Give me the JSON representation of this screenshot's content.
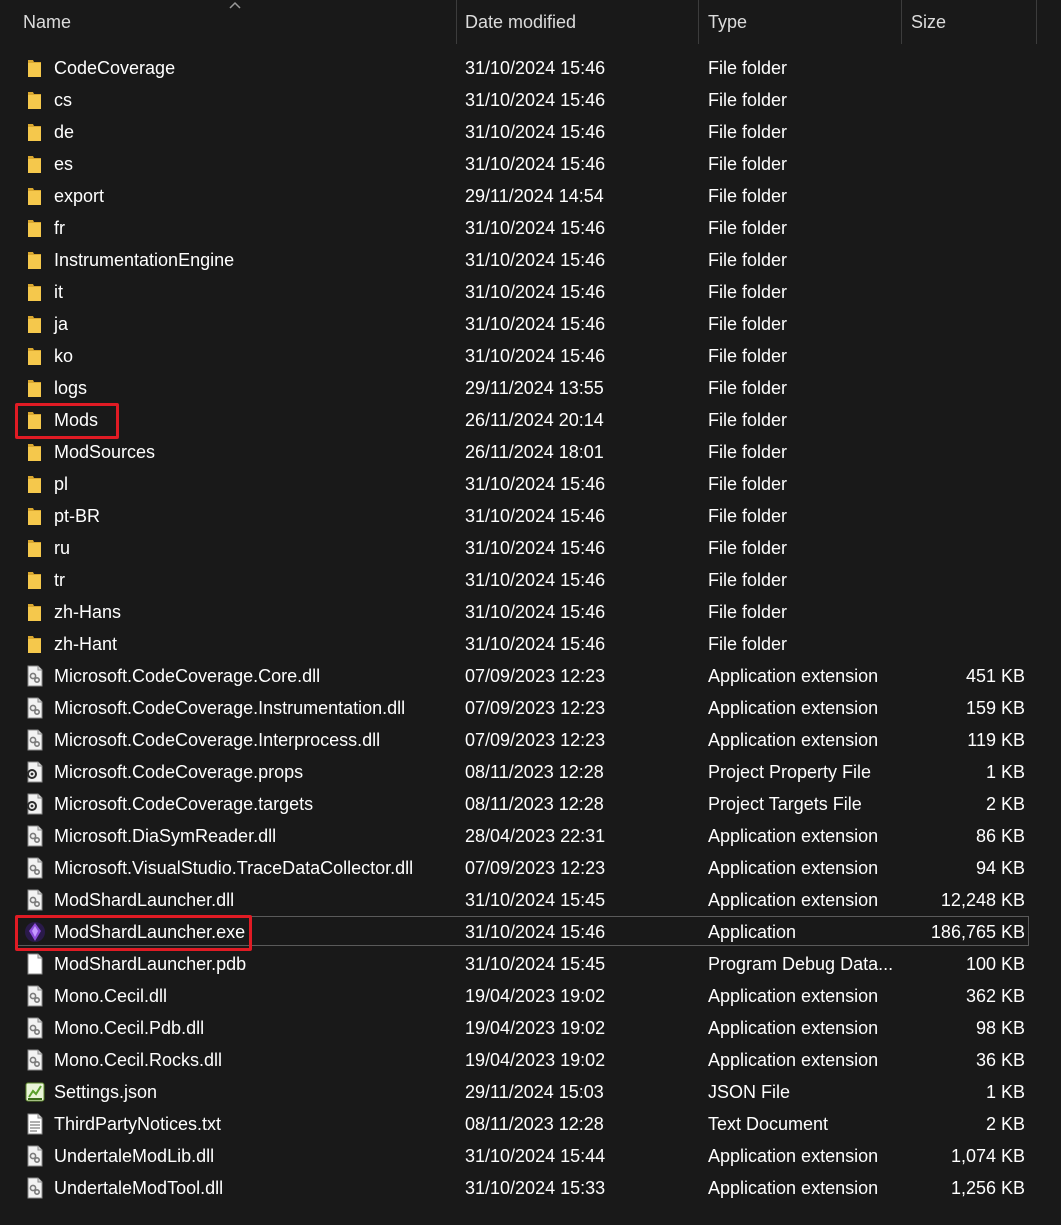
{
  "columns": {
    "name": "Name",
    "date": "Date modified",
    "type": "Type",
    "size": "Size"
  },
  "colors": {
    "background": "#191919",
    "text": "#ffffff",
    "folder": "#f5c84c",
    "highlight": "#e01b24"
  },
  "files": [
    {
      "name": "CodeCoverage",
      "date": "31/10/2024 15:46",
      "type": "File folder",
      "size": "",
      "icon": "folder-icon"
    },
    {
      "name": "cs",
      "date": "31/10/2024 15:46",
      "type": "File folder",
      "size": "",
      "icon": "folder-icon"
    },
    {
      "name": "de",
      "date": "31/10/2024 15:46",
      "type": "File folder",
      "size": "",
      "icon": "folder-icon"
    },
    {
      "name": "es",
      "date": "31/10/2024 15:46",
      "type": "File folder",
      "size": "",
      "icon": "folder-icon"
    },
    {
      "name": "export",
      "date": "29/11/2024 14:54",
      "type": "File folder",
      "size": "",
      "icon": "folder-icon"
    },
    {
      "name": "fr",
      "date": "31/10/2024 15:46",
      "type": "File folder",
      "size": "",
      "icon": "folder-icon"
    },
    {
      "name": "InstrumentationEngine",
      "date": "31/10/2024 15:46",
      "type": "File folder",
      "size": "",
      "icon": "folder-icon"
    },
    {
      "name": "it",
      "date": "31/10/2024 15:46",
      "type": "File folder",
      "size": "",
      "icon": "folder-icon"
    },
    {
      "name": "ja",
      "date": "31/10/2024 15:46",
      "type": "File folder",
      "size": "",
      "icon": "folder-icon"
    },
    {
      "name": "ko",
      "date": "31/10/2024 15:46",
      "type": "File folder",
      "size": "",
      "icon": "folder-icon"
    },
    {
      "name": "logs",
      "date": "29/11/2024 13:55",
      "type": "File folder",
      "size": "",
      "icon": "folder-icon"
    },
    {
      "name": "Mods",
      "date": "26/11/2024 20:14",
      "type": "File folder",
      "size": "",
      "icon": "folder-icon",
      "highlighted": true
    },
    {
      "name": "ModSources",
      "date": "26/11/2024 18:01",
      "type": "File folder",
      "size": "",
      "icon": "folder-icon"
    },
    {
      "name": "pl",
      "date": "31/10/2024 15:46",
      "type": "File folder",
      "size": "",
      "icon": "folder-icon"
    },
    {
      "name": "pt-BR",
      "date": "31/10/2024 15:46",
      "type": "File folder",
      "size": "",
      "icon": "folder-icon"
    },
    {
      "name": "ru",
      "date": "31/10/2024 15:46",
      "type": "File folder",
      "size": "",
      "icon": "folder-icon"
    },
    {
      "name": "tr",
      "date": "31/10/2024 15:46",
      "type": "File folder",
      "size": "",
      "icon": "folder-icon"
    },
    {
      "name": "zh-Hans",
      "date": "31/10/2024 15:46",
      "type": "File folder",
      "size": "",
      "icon": "folder-icon"
    },
    {
      "name": "zh-Hant",
      "date": "31/10/2024 15:46",
      "type": "File folder",
      "size": "",
      "icon": "folder-icon"
    },
    {
      "name": "Microsoft.CodeCoverage.Core.dll",
      "date": "07/09/2023 12:23",
      "type": "Application extension",
      "size": "451 KB",
      "icon": "dll-icon"
    },
    {
      "name": "Microsoft.CodeCoverage.Instrumentation.dll",
      "date": "07/09/2023 12:23",
      "type": "Application extension",
      "size": "159 KB",
      "icon": "dll-icon"
    },
    {
      "name": "Microsoft.CodeCoverage.Interprocess.dll",
      "date": "07/09/2023 12:23",
      "type": "Application extension",
      "size": "119 KB",
      "icon": "dll-icon"
    },
    {
      "name": "Microsoft.CodeCoverage.props",
      "date": "08/11/2023 12:28",
      "type": "Project Property File",
      "size": "1 KB",
      "icon": "project-file-icon"
    },
    {
      "name": "Microsoft.CodeCoverage.targets",
      "date": "08/11/2023 12:28",
      "type": "Project Targets File",
      "size": "2 KB",
      "icon": "project-file-icon"
    },
    {
      "name": "Microsoft.DiaSymReader.dll",
      "date": "28/04/2023 22:31",
      "type": "Application extension",
      "size": "86 KB",
      "icon": "dll-icon"
    },
    {
      "name": "Microsoft.VisualStudio.TraceDataCollector.dll",
      "date": "07/09/2023 12:23",
      "type": "Application extension",
      "size": "94 KB",
      "icon": "dll-icon"
    },
    {
      "name": "ModShardLauncher.dll",
      "date": "31/10/2024 15:45",
      "type": "Application extension",
      "size": "12,248 KB",
      "icon": "dll-icon"
    },
    {
      "name": "ModShardLauncher.exe",
      "date": "31/10/2024 15:46",
      "type": "Application",
      "size": "186,765 KB",
      "icon": "app-icon",
      "highlighted": true,
      "focused": true
    },
    {
      "name": "ModShardLauncher.pdb",
      "date": "31/10/2024 15:45",
      "type": "Program Debug Data...",
      "size": "100 KB",
      "icon": "blank-file-icon"
    },
    {
      "name": "Mono.Cecil.dll",
      "date": "19/04/2023 19:02",
      "type": "Application extension",
      "size": "362 KB",
      "icon": "dll-icon"
    },
    {
      "name": "Mono.Cecil.Pdb.dll",
      "date": "19/04/2023 19:02",
      "type": "Application extension",
      "size": "98 KB",
      "icon": "dll-icon"
    },
    {
      "name": "Mono.Cecil.Rocks.dll",
      "date": "19/04/2023 19:02",
      "type": "Application extension",
      "size": "36 KB",
      "icon": "dll-icon"
    },
    {
      "name": "Settings.json",
      "date": "29/11/2024 15:03",
      "type": "JSON File",
      "size": "1 KB",
      "icon": "json-file-icon"
    },
    {
      "name": "ThirdPartyNotices.txt",
      "date": "08/11/2023 12:28",
      "type": "Text Document",
      "size": "2 KB",
      "icon": "text-file-icon"
    },
    {
      "name": "UndertaleModLib.dll",
      "date": "31/10/2024 15:44",
      "type": "Application extension",
      "size": "1,074 KB",
      "icon": "dll-icon"
    },
    {
      "name": "UndertaleModTool.dll",
      "date": "31/10/2024 15:33",
      "type": "Application extension",
      "size": "1,256 KB",
      "icon": "dll-icon"
    }
  ]
}
